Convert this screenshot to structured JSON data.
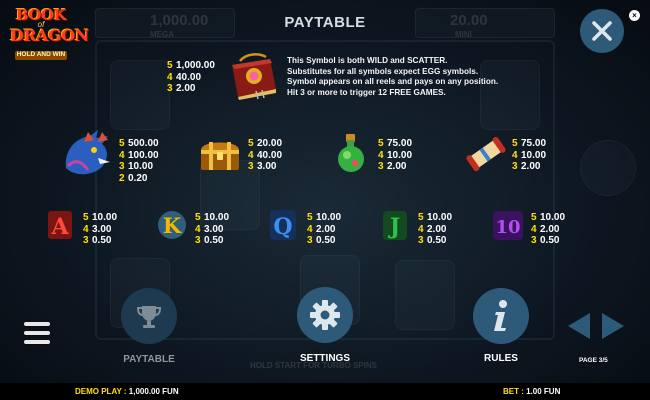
{
  "app": {
    "logo": {
      "line1": "BOOK",
      "line2": "of",
      "line3": "DRAGON",
      "line4": "HOLD AND WIN"
    },
    "title": "PAYTABLE"
  },
  "background": {
    "top_left_value": "1,000.00",
    "top_left_caption": "MEGA",
    "top_right_value": "20.00",
    "top_right_caption": "MINI",
    "hold_text": "HOLD START FOR TURBO SPINS"
  },
  "wild_symbol": {
    "icon": "book-icon",
    "pays": [
      {
        "count": "5",
        "value": "1,000.00"
      },
      {
        "count": "4",
        "value": "40.00"
      },
      {
        "count": "3",
        "value": "2.00"
      }
    ],
    "description": [
      "This Symbol is both WILD and SCATTER.",
      "Substitutes for all symbols expect EGG symbols.",
      "Symbol appears on all reels and pays on any position.",
      "Hit 3 or more to trigger 12 FREE GAMES."
    ]
  },
  "high_symbols": [
    {
      "icon": "dragon-icon",
      "pays": [
        {
          "count": "5",
          "value": "500.00"
        },
        {
          "count": "4",
          "value": "100.00"
        },
        {
          "count": "3",
          "value": "10.00"
        },
        {
          "count": "2",
          "value": "0.20"
        }
      ]
    },
    {
      "icon": "treasure-chest-icon",
      "pays": [
        {
          "count": "5",
          "value": "20.00"
        },
        {
          "count": "4",
          "value": "40.00"
        },
        {
          "count": "3",
          "value": "3.00"
        }
      ]
    },
    {
      "icon": "potion-icon",
      "pays": [
        {
          "count": "5",
          "value": "75.00"
        },
        {
          "count": "4",
          "value": "10.00"
        },
        {
          "count": "3",
          "value": "2.00"
        }
      ]
    },
    {
      "icon": "scroll-icon",
      "pays": [
        {
          "count": "5",
          "value": "75.00"
        },
        {
          "count": "4",
          "value": "10.00"
        },
        {
          "count": "3",
          "value": "2.00"
        }
      ]
    }
  ],
  "low_symbols": [
    {
      "icon": "letter-a-icon",
      "glyph": "A",
      "color": "#e0302a",
      "pays": [
        {
          "count": "5",
          "value": "10.00"
        },
        {
          "count": "4",
          "value": "3.00"
        },
        {
          "count": "3",
          "value": "0.50"
        }
      ]
    },
    {
      "icon": "letter-k-icon",
      "glyph": "K",
      "color": "#f0b000",
      "pays": [
        {
          "count": "5",
          "value": "10.00"
        },
        {
          "count": "4",
          "value": "3.00"
        },
        {
          "count": "3",
          "value": "0.50"
        }
      ]
    },
    {
      "icon": "letter-q-icon",
      "glyph": "Q",
      "color": "#2a7fe0",
      "pays": [
        {
          "count": "5",
          "value": "10.00"
        },
        {
          "count": "4",
          "value": "2.00"
        },
        {
          "count": "3",
          "value": "0.50"
        }
      ]
    },
    {
      "icon": "letter-j-icon",
      "glyph": "J",
      "color": "#28b040",
      "pays": [
        {
          "count": "5",
          "value": "10.00"
        },
        {
          "count": "4",
          "value": "2.00"
        },
        {
          "count": "3",
          "value": "0.50"
        }
      ]
    },
    {
      "icon": "number-10-icon",
      "glyph": "10",
      "color": "#a040e0",
      "pays": [
        {
          "count": "5",
          "value": "10.00"
        },
        {
          "count": "4",
          "value": "2.00"
        },
        {
          "count": "3",
          "value": "0.50"
        }
      ]
    }
  ],
  "controls": {
    "paytable_label": "PAYTABLE",
    "settings_label": "SETTINGS",
    "rules_label": "RULES",
    "page_indicator": "PAGE 3/5"
  },
  "status_bar": {
    "demo_label": "DEMO PLAY : ",
    "demo_value": "1,000.00 FUN",
    "bet_label": "BET : ",
    "bet_value": "1.00 FUN"
  },
  "colors": {
    "accent_yellow": "#ffe100",
    "button_blue": "#2e5a79",
    "button_blue_dim": "#1e3a50"
  }
}
